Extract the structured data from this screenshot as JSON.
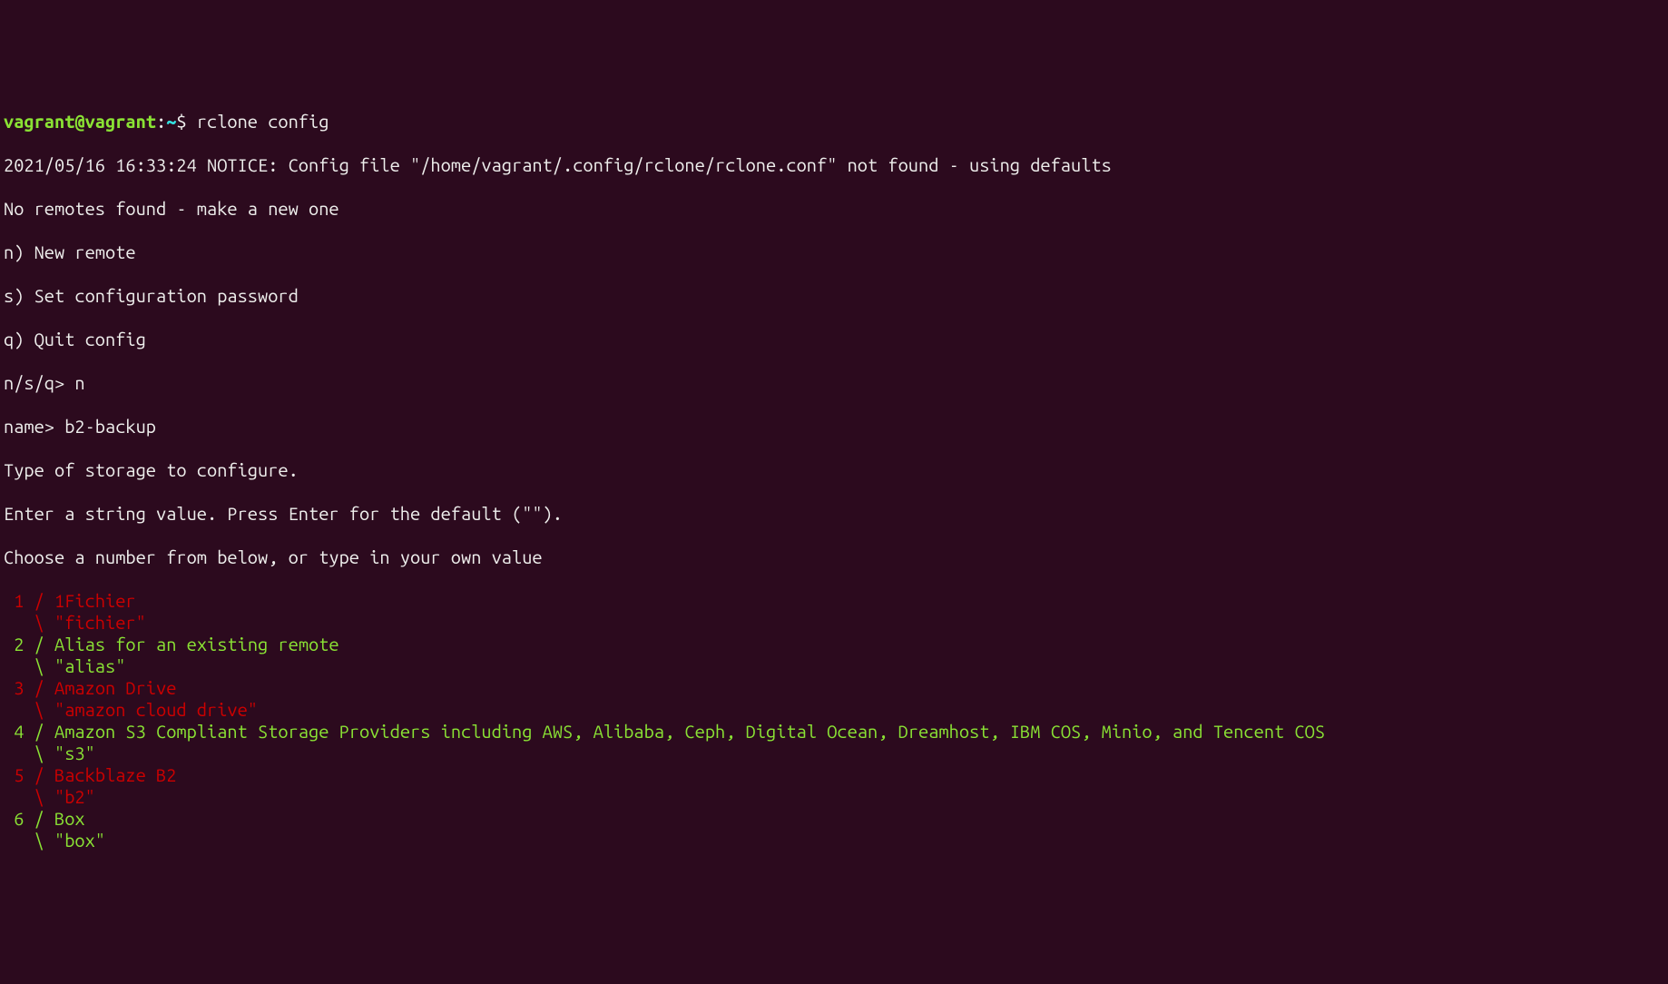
{
  "prompt": {
    "user": "vagrant@vagrant",
    "sep": ":",
    "path": "~",
    "dollar": "$",
    "command": "rclone config"
  },
  "lines": {
    "l1": "2021/05/16 16:33:24 NOTICE: Config file \"/home/vagrant/.config/rclone/rclone.conf\" not found - using defaults",
    "l2": "No remotes found - make a new one",
    "l3": "n) New remote",
    "l4": "s) Set configuration password",
    "l5": "q) Quit config",
    "l6a": "n/s/q> ",
    "l6b": "n",
    "l7a": "name> ",
    "l7b": "b2-backup",
    "l8": "Type of storage to configure.",
    "l9": "Enter a string value. Press Enter for the default (\"\").",
    "l10": "Choose a number from below, or type in your own value"
  },
  "options": [
    {
      "num": " 1",
      "slash": " / ",
      "name": "1Fichier",
      "back": "   \\ ",
      "code": "\"fichier\"",
      "color": "crimson"
    },
    {
      "num": " 2",
      "slash": " / ",
      "name": "Alias for an existing remote",
      "back": "   \\ ",
      "code": "\"alias\"",
      "color": "green"
    },
    {
      "num": " 3",
      "slash": " / ",
      "name": "Amazon Drive",
      "back": "   \\ ",
      "code": "\"amazon cloud drive\"",
      "color": "crimson"
    },
    {
      "num": " 4",
      "slash": " / ",
      "name": "Amazon S3 Compliant Storage Providers including AWS, Alibaba, Ceph, Digital Ocean, Dreamhost, IBM COS, Minio, and Tencent COS",
      "back": "   \\ ",
      "code": "\"s3\"",
      "color": "green"
    },
    {
      "num": " 5",
      "slash": " / ",
      "name": "Backblaze B2",
      "back": "   \\ ",
      "code": "\"b2\"",
      "color": "crimson"
    },
    {
      "num": " 6",
      "slash": " / ",
      "name": "Box",
      "back": "   \\ ",
      "code": "\"box\"",
      "color": "green"
    }
  ]
}
